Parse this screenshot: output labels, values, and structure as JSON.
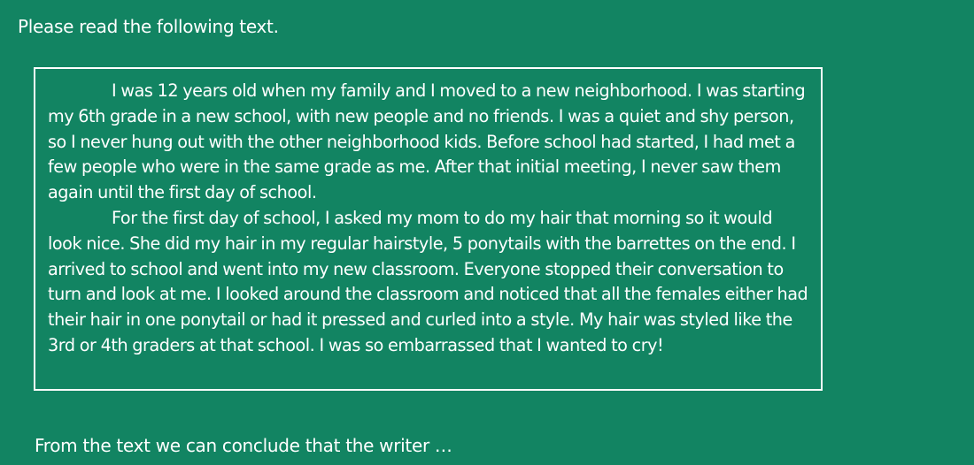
{
  "instruction": "Please read the following text.",
  "passage": {
    "paragraphs": [
      "I was 12 years old when my family and I moved to a new neighborhood. I was starting my 6th grade in a new school, with new people and no friends. I was a quiet and shy person, so I never hung out with the other neighborhood kids. Before school had started, I had met a few people who were in the same grade as me. After that initial meeting, I never saw them again until the first day of school.",
      "For the first day of school, I asked my mom to do my hair that morning so it would look nice. She did my hair in my regular hairstyle, 5 ponytails with the barrettes on the end. I arrived to school and went into my new classroom. Everyone stopped their conversation to turn and look at me. I looked around the classroom and noticed that all the females either had their hair in one ponytail or had it pressed and curled into a style. My hair was styled like the 3rd or 4th graders at that school. I was so embarrassed that I wanted to cry!"
    ]
  },
  "question": "From the text we can conclude that the writer …",
  "colors": {
    "background": "#128462",
    "text": "#ffffff",
    "border": "#ffffff"
  }
}
